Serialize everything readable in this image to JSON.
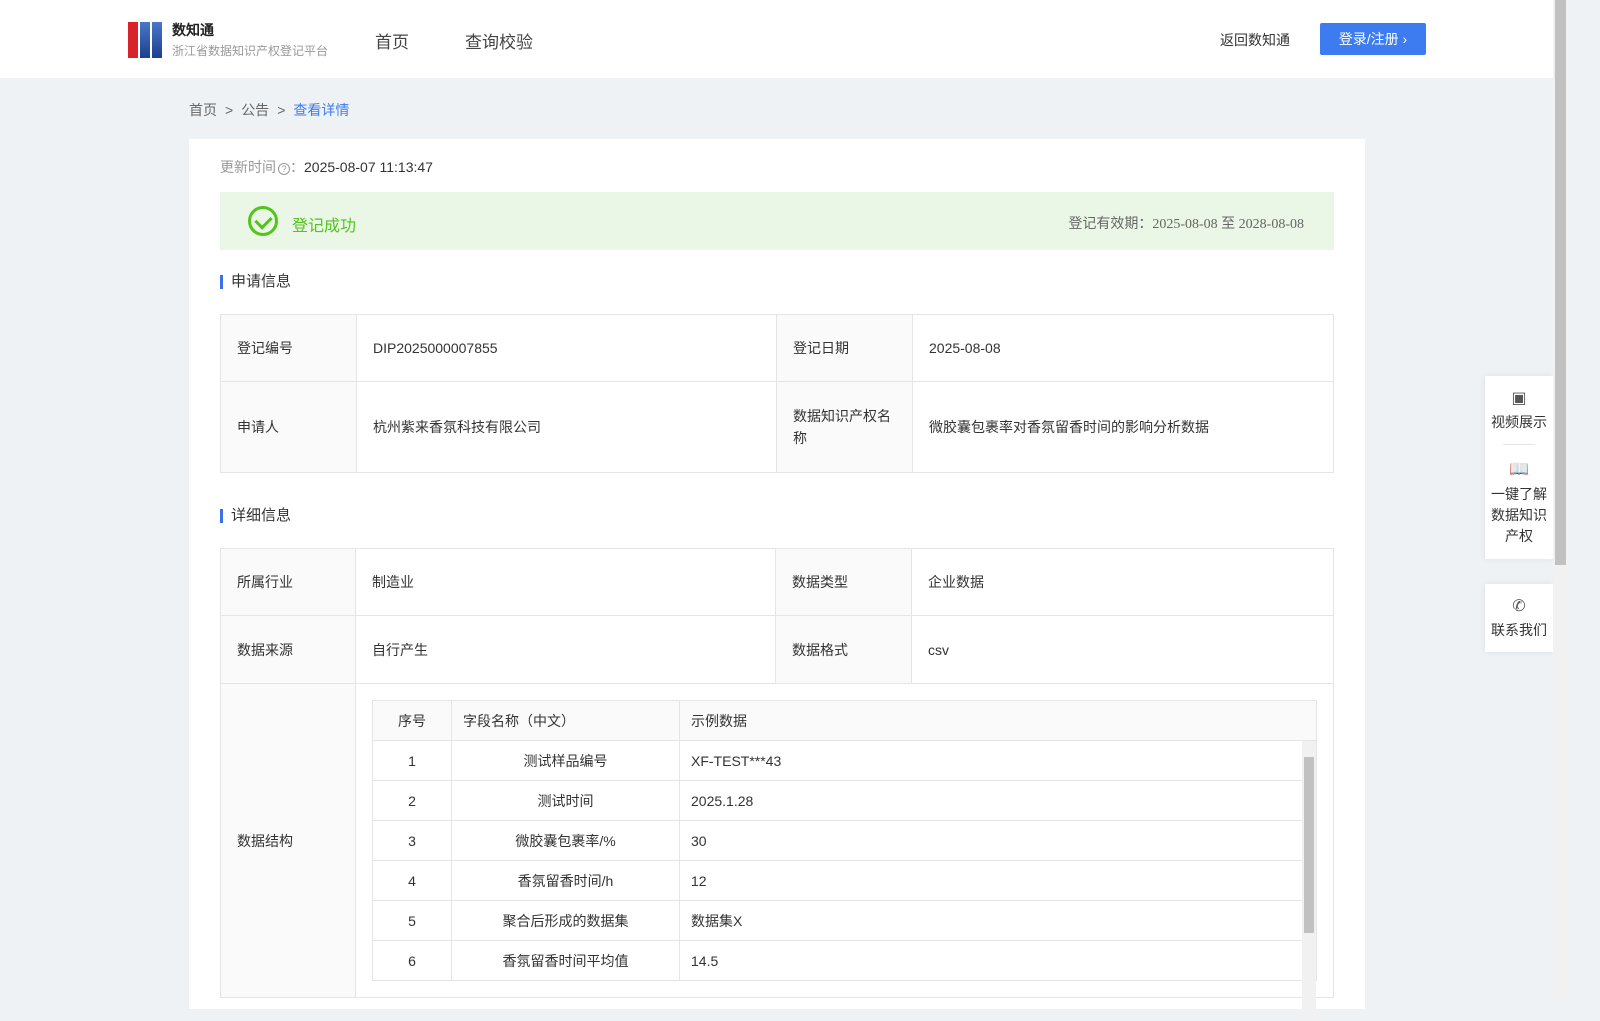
{
  "header": {
    "logo_title": "数知通",
    "logo_subtitle": "浙江省数据知识产权登记平台",
    "nav": [
      "首页",
      "查询校验"
    ],
    "back": "返回数知通",
    "login": "登录/注册 ›"
  },
  "breadcrumb": [
    "首页",
    "公告",
    "查看详情"
  ],
  "update": {
    "label": "更新时间",
    "value": "2025-08-07 11:13:47"
  },
  "status": {
    "text": "登记成功",
    "validity_label": "登记有效期：",
    "validity": "2025-08-08 至 2028-08-08"
  },
  "apply": {
    "title": "申请信息",
    "rows": [
      [
        "登记编号",
        "DIP2025000007855",
        "登记日期",
        "2025-08-08"
      ],
      [
        "申请人",
        "杭州紫来香氛科技有限公司",
        "数据知识产权名称",
        "微胶囊包裹率对香氛留香时间的影响分析数据"
      ]
    ]
  },
  "detail": {
    "title": "详细信息",
    "rows": [
      [
        "所属行业",
        "制造业",
        "数据类型",
        "企业数据"
      ],
      [
        "数据来源",
        "自行产生",
        "数据格式",
        "csv"
      ]
    ],
    "structure_label": "数据结构",
    "columns": [
      "序号",
      "字段名称（中文）",
      "示例数据"
    ],
    "fields": [
      [
        "1",
        "测试样品编号",
        "XF-TEST***43"
      ],
      [
        "2",
        "测试时间",
        "2025.1.28"
      ],
      [
        "3",
        "微胶囊包裹率/%",
        "30"
      ],
      [
        "4",
        "香氛留香时间/h",
        "12"
      ],
      [
        "5",
        "聚合后形成的数据集",
        "数据集X"
      ],
      [
        "6",
        "香氛留香时间平均值",
        "14.5"
      ]
    ]
  },
  "side": [
    "视频展示",
    "一键了解数据知识产权",
    "联系我们"
  ]
}
